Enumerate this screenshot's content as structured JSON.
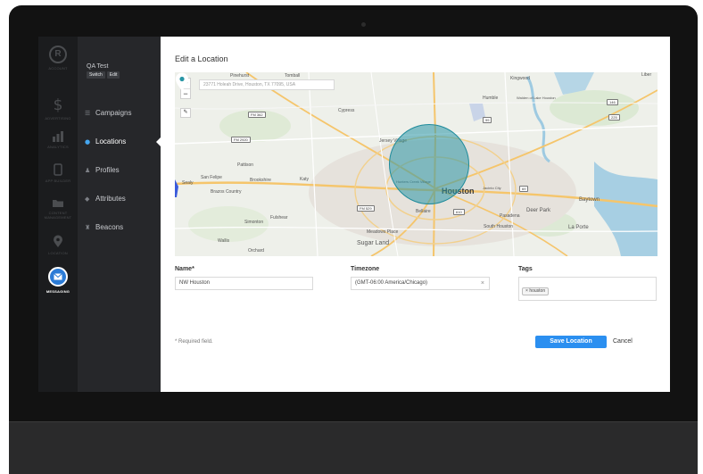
{
  "rail": {
    "logo_label": "ACCOUNT",
    "items": [
      {
        "icon": "dollar-icon",
        "glyph": "$",
        "label": "ADVERTISING"
      },
      {
        "icon": "chart-icon",
        "glyph": "▀",
        "label": "ANALYTICS"
      },
      {
        "icon": "phone-icon",
        "glyph": "▯",
        "label": "APP BUILDER"
      },
      {
        "icon": "folder-icon",
        "glyph": "▬",
        "label": "CONTENT MANAGEMENT"
      },
      {
        "icon": "map-pin-icon",
        "glyph": "▼",
        "label": "LOCATION"
      },
      {
        "icon": "envelope-icon",
        "glyph": "✉",
        "label": "MESSAGING"
      }
    ]
  },
  "account": {
    "name": "QA Test",
    "switch_label": "Switch",
    "edit_label": "Edit"
  },
  "nav": {
    "items": [
      {
        "label": "Campaigns",
        "icon": "list-icon"
      },
      {
        "label": "Locations",
        "icon": "map-pin-icon"
      },
      {
        "label": "Profiles",
        "icon": "user-icon"
      },
      {
        "label": "Attributes",
        "icon": "tag-icon"
      },
      {
        "label": "Beacons",
        "icon": "beacon-icon"
      }
    ],
    "active": "Locations"
  },
  "page": {
    "title": "Edit a Location"
  },
  "map": {
    "search_value": "23771 Holeah Drive, Houston, TX 77095, USA",
    "zoom_in": "+",
    "zoom_out": "−",
    "labels": {
      "pinehurst": "Pinehurst",
      "tomball": "Tomball",
      "kingwood": "Kingwood",
      "liberty": "Liber",
      "humble": "Humble",
      "cypress": "Cypress",
      "jersey_village": "Jersey Village",
      "potkam": "Pattison",
      "katy": "Katy",
      "brookshire": "Brookshire",
      "san_felipe": "San Felipe",
      "sealy": "Sealy",
      "brazos": "Brazos Country",
      "fulshear": "Fulshear",
      "simonton": "Simonton",
      "wallis": "Wallis",
      "orchard": "Orchard",
      "houston": "Houston",
      "hunters": "Hunters Creek Village",
      "bellaire": "Bellaire",
      "meadows": "Meadows Place",
      "sugar_land": "Sugar Land",
      "pasadena": "Pasadena",
      "south_houston": "South Houston",
      "deer_park": "Deer Park",
      "baytown": "Baytown",
      "la_porte": "La Porte",
      "jacinto": "Jacinto City",
      "waldenfalls": "Walden of Lake Houston"
    },
    "shields": [
      "FM 362",
      "FM 2920",
      "FM 529",
      "99",
      "610",
      "225",
      "146",
      "69"
    ]
  },
  "form": {
    "name_label": "Name*",
    "name_value": "NW Houston",
    "timezone_label": "Timezone",
    "timezone_value": "(GMT-06:00 America/Chicago)",
    "timezone_clear": "×",
    "tags_label": "Tags",
    "tags": [
      "houston"
    ],
    "tag_remove": "×",
    "required_note": "* Required field.",
    "save_label": "Save Location",
    "cancel_label": "Cancel"
  }
}
